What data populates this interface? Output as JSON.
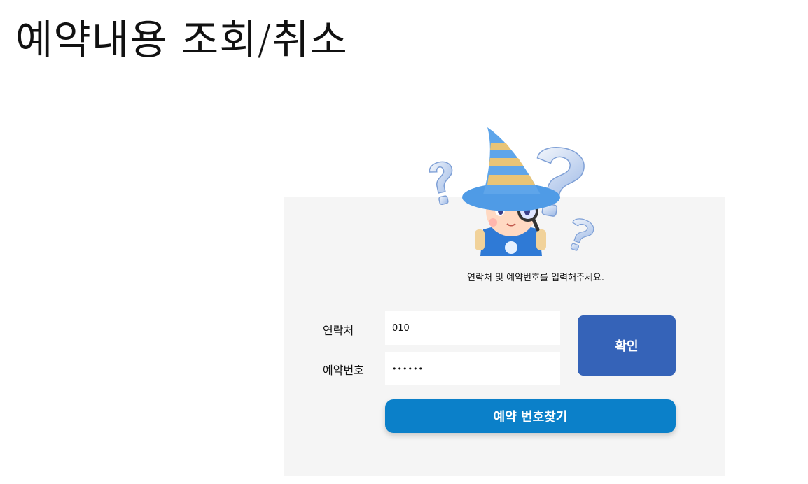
{
  "page": {
    "title": "예약내용 조회/취소"
  },
  "form": {
    "instruction": "연락처 및 예약번호를 입력해주세요.",
    "contact_label": "연락처",
    "contact_value": "010",
    "reservation_label": "예약번호",
    "reservation_value": "••••••",
    "confirm_label": "확인",
    "find_label": "예약 번호찾기"
  },
  "colors": {
    "panel_bg": "#f5f5f5",
    "confirm_bg": "#3563b8",
    "find_bg": "#0b80c9"
  },
  "illustration": {
    "icon": "wizard-mascot-with-question-marks"
  }
}
